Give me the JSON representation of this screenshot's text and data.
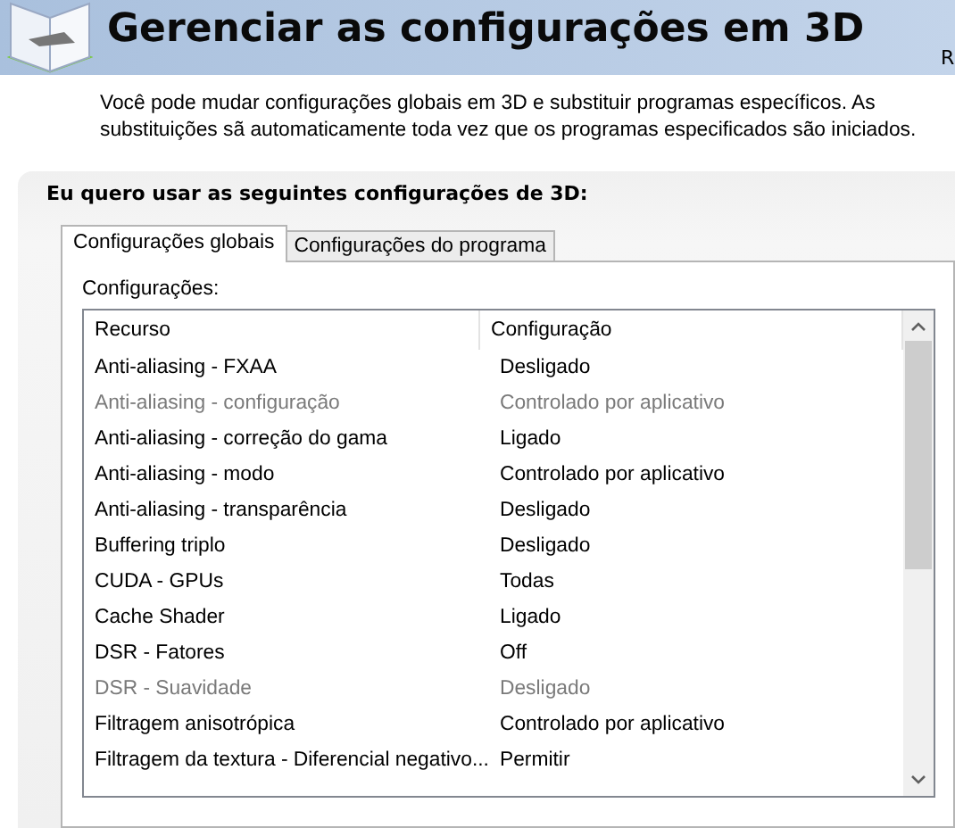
{
  "header": {
    "title": "Gerenciar as configurações em 3D",
    "edge_text": "R"
  },
  "description": "Você pode mudar configurações globais em 3D e substituir programas específicos. As substituições sã automaticamente toda vez que os programas especificados são iniciados.",
  "section_title": "Eu quero usar as seguintes configurações de 3D:",
  "tabs": [
    {
      "label": "Configurações globais",
      "selected": true
    },
    {
      "label": "Configurações do programa",
      "selected": false
    }
  ],
  "list_label": "Configurações:",
  "table": {
    "columns": [
      "Recurso",
      "Configuração"
    ],
    "rows": [
      {
        "feature": "Anti-aliasing - FXAA",
        "setting": "Desligado",
        "disabled": false
      },
      {
        "feature": "Anti-aliasing - configuração",
        "setting": "Controlado por aplicativo",
        "disabled": true
      },
      {
        "feature": "Anti-aliasing - correção do gama",
        "setting": "Ligado",
        "disabled": false
      },
      {
        "feature": "Anti-aliasing - modo",
        "setting": "Controlado por aplicativo",
        "disabled": false
      },
      {
        "feature": "Anti-aliasing - transparência",
        "setting": "Desligado",
        "disabled": false
      },
      {
        "feature": "Buffering triplo",
        "setting": "Desligado",
        "disabled": false
      },
      {
        "feature": "CUDA - GPUs",
        "setting": "Todas",
        "disabled": false
      },
      {
        "feature": "Cache Shader",
        "setting": "Ligado",
        "disabled": false
      },
      {
        "feature": "DSR - Fatores",
        "setting": "Off",
        "disabled": false
      },
      {
        "feature": "DSR - Suavidade",
        "setting": "Desligado",
        "disabled": true
      },
      {
        "feature": "Filtragem anisotrópica",
        "setting": "Controlado por aplicativo",
        "disabled": false
      },
      {
        "feature": "Filtragem da textura - Diferencial negativo...",
        "setting": "Permitir",
        "disabled": false
      }
    ]
  }
}
